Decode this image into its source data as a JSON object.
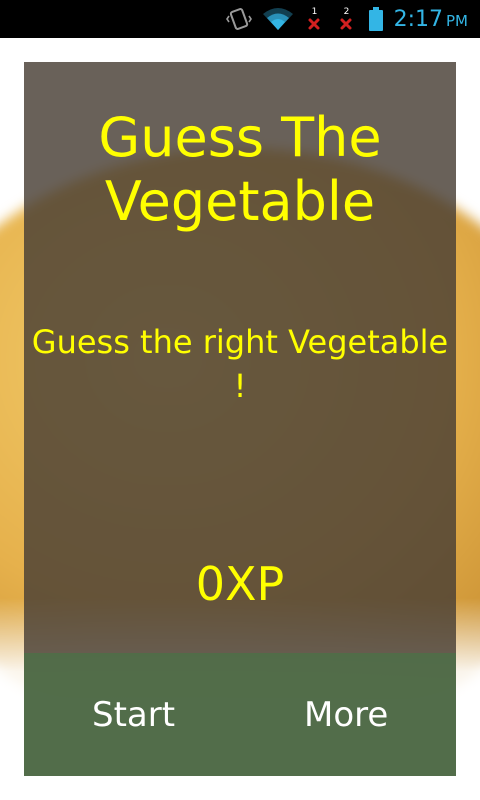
{
  "status_bar": {
    "time": "2:17",
    "ampm": "PM",
    "sim1_label": "1",
    "sim2_label": "2",
    "icons": [
      "vibrate-icon",
      "wifi-icon",
      "sim1-no-signal-icon",
      "sim2-no-signal-icon",
      "battery-icon"
    ],
    "clock_color": "#33b5e5"
  },
  "game": {
    "title": "Guess The Vegetable",
    "subtitle": "Guess the right Vegetable !",
    "score": "0XP",
    "start_label": "Start",
    "more_label": "More"
  },
  "colors": {
    "text_accent": "#ffff00",
    "button_text": "#ffffff",
    "panel": "#483e34",
    "bottom_bar": "#4e6e48"
  }
}
